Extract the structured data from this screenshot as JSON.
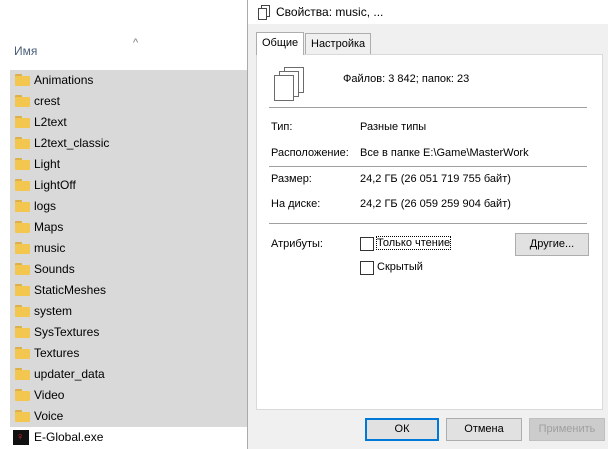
{
  "explorer": {
    "column_header": "Имя",
    "items": [
      {
        "name": "Animations",
        "type": "folder"
      },
      {
        "name": "crest",
        "type": "folder"
      },
      {
        "name": "L2text",
        "type": "folder"
      },
      {
        "name": "L2text_classic",
        "type": "folder"
      },
      {
        "name": "Light",
        "type": "folder"
      },
      {
        "name": "LightOff",
        "type": "folder"
      },
      {
        "name": "logs",
        "type": "folder"
      },
      {
        "name": "Maps",
        "type": "folder"
      },
      {
        "name": "music",
        "type": "folder"
      },
      {
        "name": "Sounds",
        "type": "folder"
      },
      {
        "name": "StaticMeshes",
        "type": "folder"
      },
      {
        "name": "system",
        "type": "folder"
      },
      {
        "name": "SysTextures",
        "type": "folder"
      },
      {
        "name": "Textures",
        "type": "folder"
      },
      {
        "name": "updater_data",
        "type": "folder"
      },
      {
        "name": "Video",
        "type": "folder"
      },
      {
        "name": "Voice",
        "type": "folder"
      },
      {
        "name": "E-Global.exe",
        "type": "exe"
      }
    ]
  },
  "dialog": {
    "title": "Свойства: music, ...",
    "tabs": [
      "Общие",
      "Настройка"
    ],
    "active_tab": 0,
    "summary": "Файлов: 3 842; папок: 23",
    "type_label": "Тип:",
    "type_value": "Разные типы",
    "location_label": "Расположение:",
    "location_value": "Все в папке E:\\Game\\MasterWork",
    "size_label": "Размер:",
    "size_value": "24,2 ГБ (26 051 719 755 байт)",
    "disk_label": "На диске:",
    "disk_value": "24,2 ГБ (26 059 259 904 байт)",
    "attributes_label": "Атрибуты:",
    "readonly_label": "Только чтение",
    "hidden_label": "Скрытый",
    "other_button": "Другие...",
    "ok_button": "ОК",
    "cancel_button": "Отмена",
    "apply_button": "Применить"
  }
}
